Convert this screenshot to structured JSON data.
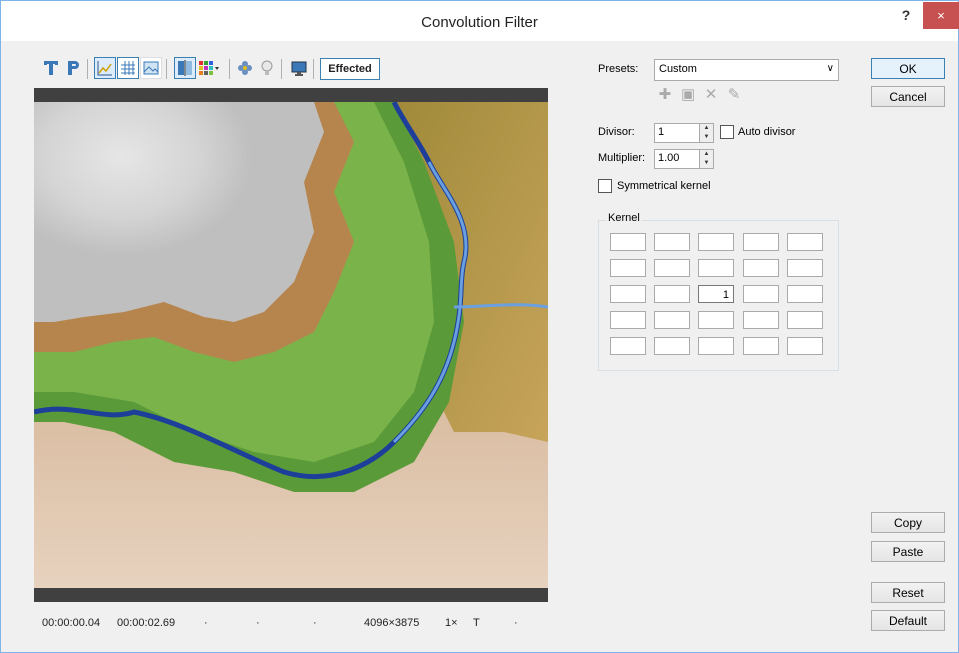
{
  "window": {
    "title": "Convolution Filter",
    "help_label": "?",
    "close_label": "×"
  },
  "toolbar": {
    "effected_label": "Effected",
    "icons": [
      "text-icon",
      "p-icon",
      "chart-icon",
      "grid-icon",
      "image-icon",
      "split-icon",
      "palette-icon",
      "flower-icon",
      "bulb-icon",
      "monitor-icon"
    ]
  },
  "status": {
    "time_current": "00:00:00.04",
    "time_total": "00:00:02.69",
    "dot1": "·",
    "dot2": "·",
    "dot3": "·",
    "resolution": "4096×3875",
    "zoom": "1×",
    "mode": "T",
    "dot4": "·"
  },
  "presets": {
    "label": "Presets:",
    "value": "Custom"
  },
  "divisor": {
    "label": "Divisor:",
    "value": "1",
    "auto_label": "Auto divisor",
    "auto_checked": false
  },
  "multiplier": {
    "label": "Multiplier:",
    "value": "1.00"
  },
  "symmetrical": {
    "label": "Symmetrical kernel",
    "checked": false
  },
  "kernel": {
    "title": "Kernel",
    "rows": [
      [
        "",
        "",
        "",
        "",
        ""
      ],
      [
        "",
        "",
        "",
        "",
        ""
      ],
      [
        "",
        "",
        "1",
        "",
        ""
      ],
      [
        "",
        "",
        "",
        "",
        ""
      ],
      [
        "",
        "",
        "",
        "",
        ""
      ]
    ]
  },
  "buttons": {
    "ok": "OK",
    "cancel": "Cancel",
    "copy": "Copy",
    "paste": "Paste",
    "reset": "Reset",
    "default": "Default"
  },
  "colors": {
    "accent": "#3c7fb1",
    "close": "#c75050"
  }
}
